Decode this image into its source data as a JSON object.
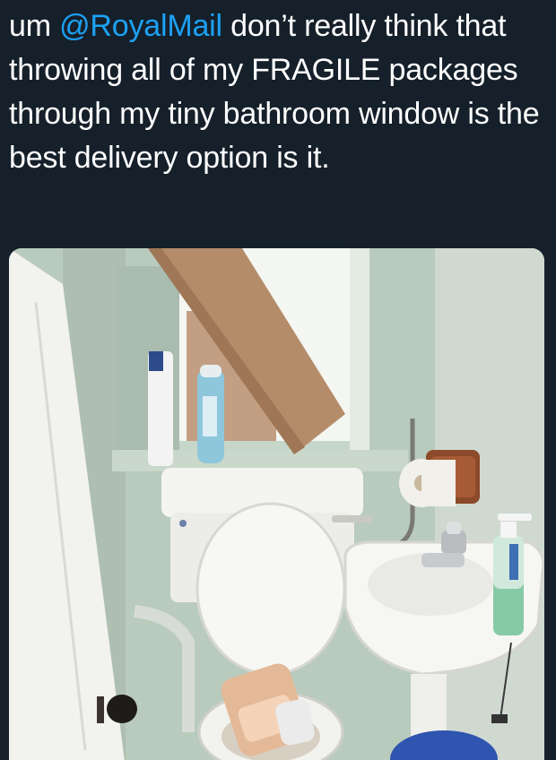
{
  "tweet": {
    "text_prefix": "um ",
    "mention": "@RoyalMail",
    "text_body": " don’t really think that throwing all of my FRAGILE packages through my tiny bathroom window is the best delivery option is it."
  },
  "media": {
    "subject": "bathroom with a cardboard package wedged through a small window above a toilet and a sink",
    "icons": [
      "parcel-box",
      "toilet",
      "sink",
      "tap",
      "toilet-roll",
      "soap-dispenser",
      "air-freshener",
      "door-handle"
    ]
  },
  "colors": {
    "background": "#15202b",
    "text": "#ffffff",
    "mention": "#1da1f2",
    "wall": "#b7c8bb",
    "cardboard": "#b58c6a"
  }
}
